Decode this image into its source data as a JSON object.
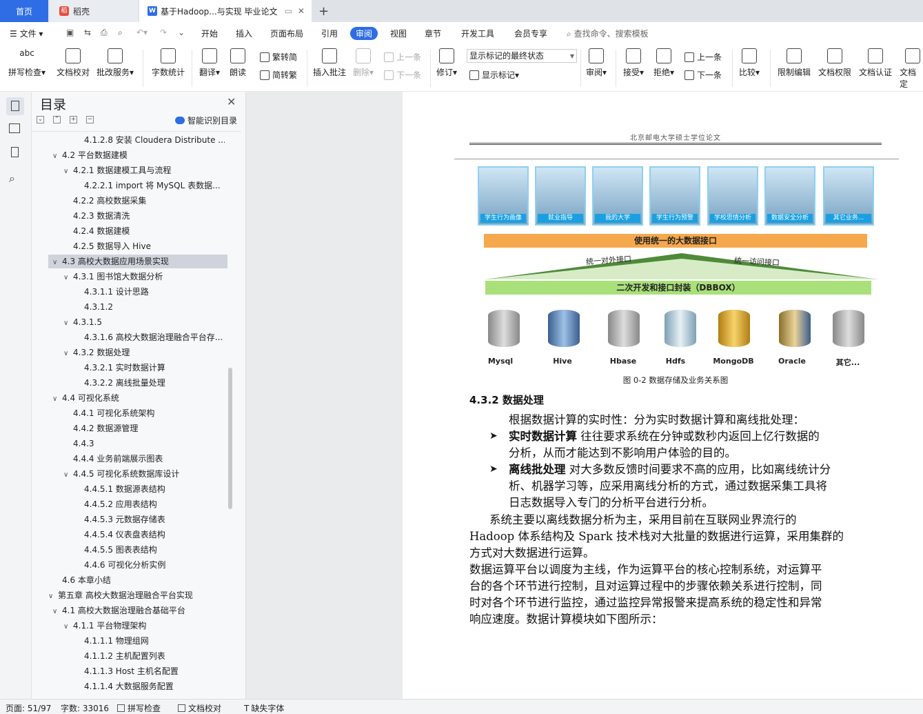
{
  "tabs": {
    "home": "首页",
    "daoke": "稻壳",
    "document": "基于Hadoop...与实现 毕业论文",
    "new_tab": "+"
  },
  "menu": {
    "file": "文件",
    "start": "开始",
    "insert": "插入",
    "layout": "页面布局",
    "reference": "引用",
    "review": "审阅",
    "view": "视图",
    "chapter": "章节",
    "devtools": "开发工具",
    "member": "会员专享",
    "search": "查找命令、搜索模板"
  },
  "ribbon": {
    "spell": "拼写检查",
    "doccheck": "文档校对",
    "batch": "批改服务",
    "wordcount": "字数统计",
    "translate": "翻译",
    "read": "朗读",
    "to_trad": "繁转简",
    "to_simp": "简转繁",
    "insert_comment": "插入批注",
    "delete": "删除",
    "prev": "上一条",
    "next": "下一条",
    "revise": "修订",
    "markup_select": "显示标记的最终状态",
    "show_markup": "显示标记",
    "review_pane": "审阅",
    "accept": "接受",
    "reject": "拒绝",
    "prev2": "上一条",
    "next2": "下一条",
    "compare": "比较",
    "restrict": "限制编辑",
    "doc_perm": "文档权限",
    "doc_cert": "文档认证",
    "doc_final": "文档定"
  },
  "toc": {
    "title": "目录",
    "smart": "智能识别目录",
    "items": [
      {
        "text": "4.1.2.8 安装 Cloudera Distribute ...",
        "level": 3,
        "caret": ""
      },
      {
        "text": "4.2 平台数据建模",
        "level": 1,
        "caret": "v"
      },
      {
        "text": "4.2.1 数据建模工具与流程",
        "level": 2,
        "caret": "v"
      },
      {
        "text": "4.2.2.1 import 将 MySQL 表数据...",
        "level": 3,
        "caret": ""
      },
      {
        "text": "4.2.2 高校数据采集",
        "level": 2,
        "caret": ""
      },
      {
        "text": "4.2.3 数据清洗",
        "level": 2,
        "caret": ""
      },
      {
        "text": "4.2.4 数据建模",
        "level": 2,
        "caret": ""
      },
      {
        "text": "4.2.5 数据导入 Hive",
        "level": 2,
        "caret": ""
      },
      {
        "text": "4.3 高校大数据应用场景实现",
        "level": 1,
        "caret": "v",
        "selected": true
      },
      {
        "text": "4.3.1 图书馆大数据分析",
        "level": 2,
        "caret": "v"
      },
      {
        "text": "4.3.1.1 设计思路",
        "level": 3,
        "caret": ""
      },
      {
        "text": "4.3.1.2",
        "level": 3,
        "caret": ""
      },
      {
        "text": "4.3.1.5",
        "level": 2,
        "caret": "v"
      },
      {
        "text": "4.3.1.6 高校大数据治理融合平台存...",
        "level": 3,
        "caret": ""
      },
      {
        "text": "4.3.2 数据处理",
        "level": 2,
        "caret": "v"
      },
      {
        "text": "4.3.2.1 实时数据计算",
        "level": 3,
        "caret": ""
      },
      {
        "text": "4.3.2.2 离线批量处理",
        "level": 3,
        "caret": ""
      },
      {
        "text": "4.4 可视化系统",
        "level": 1,
        "caret": "v"
      },
      {
        "text": "4.4.1 可视化系统架构",
        "level": 2,
        "caret": ""
      },
      {
        "text": "4.4.2 数据源管理",
        "level": 2,
        "caret": ""
      },
      {
        "text": "4.4.3",
        "level": 2,
        "caret": ""
      },
      {
        "text": "4.4.4 业务前端展示图表",
        "level": 2,
        "caret": ""
      },
      {
        "text": "4.4.5 可视化系统数据库设计",
        "level": 2,
        "caret": "v"
      },
      {
        "text": "4.4.5.1 数据源表结构",
        "level": 3,
        "caret": ""
      },
      {
        "text": "4.4.5.2 应用表结构",
        "level": 3,
        "caret": ""
      },
      {
        "text": "4.4.5.3 元数据存储表",
        "level": 3,
        "caret": ""
      },
      {
        "text": "4.4.5.4 仪表盘表结构",
        "level": 3,
        "caret": ""
      },
      {
        "text": "4.4.5.5 图表表结构",
        "level": 3,
        "caret": ""
      },
      {
        "text": "4.4.6 可视化分析实例",
        "level": 3,
        "caret": ""
      },
      {
        "text": "4.6 本章小结",
        "level": 1,
        "caret": ""
      },
      {
        "text": "第五章 高校大数据治理融合平台实现",
        "level": 0,
        "caret": "v"
      },
      {
        "text": "4.1 高校大数据治理融合基础平台",
        "level": 1,
        "caret": "v"
      },
      {
        "text": "4.1.1 平台物理架构",
        "level": 2,
        "caret": "v"
      },
      {
        "text": "4.1.1.1 物理组网",
        "level": 3,
        "caret": ""
      },
      {
        "text": "4.1.1.2 主机配置列表",
        "level": 3,
        "caret": ""
      },
      {
        "text": "4.1.1.3 Host 主机名配置",
        "level": 3,
        "caret": ""
      },
      {
        "text": "4.1.1.4 大数据服务配置",
        "level": 3,
        "caret": ""
      }
    ]
  },
  "document": {
    "header": "北京邮电大学硕士学位论文",
    "figure": {
      "tiles": [
        "学生行为画像",
        "就业指导",
        "我的大学",
        "学生行为预警",
        "学校思情分析",
        "数据安全分析",
        "其它业务..."
      ],
      "orange_bar": "使用统一的大数据接口",
      "left_interface": "统一对外接口",
      "right_interface": "统一访问接口",
      "green_bar": "二次开发和接口封装（DBBOX）",
      "databases": [
        "Mysql",
        "Hive",
        "Hbase",
        "Hdfs",
        "MongoDB",
        "Oracle",
        "其它..."
      ],
      "caption": "图 0-2 数据存储及业务关系图"
    },
    "section_title": "4.3.2  数据处理",
    "intro": "根据数据计算的实时性：分为实时数据计算和离线批处理：",
    "bullet1_bold": "实时数据计算",
    "bullet1_line1": " 往往要求系统在分钟或数秒内返回上亿行数据的",
    "bullet1_line2": "分析，从而才能达到不影响用户体验的目的。",
    "bullet2_bold": "离线批处理",
    "bullet2_line1": " 对大多数反馈时间要求不高的应用，比如离线统计分",
    "bullet2_line2": "析、机器学习等，应采用离线分析的方式，通过数据采集工具将",
    "bullet2_line3": "日志数据导入专门的分析平台进行分析。",
    "p1_line1": "系统主要以离线数据分析为主，采用目前在互联网业界流行的",
    "p1_line2": "Hadoop 体系结构及 Spark 技术栈对大批量的数据进行运算，采用集群的",
    "p1_line3": "方式对大数据进行运算。",
    "p2_line1": "数据运算平台以调度为主线，作为运算平台的核心控制系统，对运算平",
    "p2_line2": "台的各个环节进行控制，且对运算过程中的步骤依赖关系进行控制，同",
    "p2_line3": "时对各个环节进行监控，通过监控异常报警来提高系统的稳定性和异常",
    "p2_line4": "响应速度。数据计算模块如下图所示："
  },
  "status": {
    "page": "页面: 51/97",
    "words": "字数: 33016",
    "spell": "拼写检查",
    "doccheck": "文档校对",
    "font": "缺失字体"
  }
}
